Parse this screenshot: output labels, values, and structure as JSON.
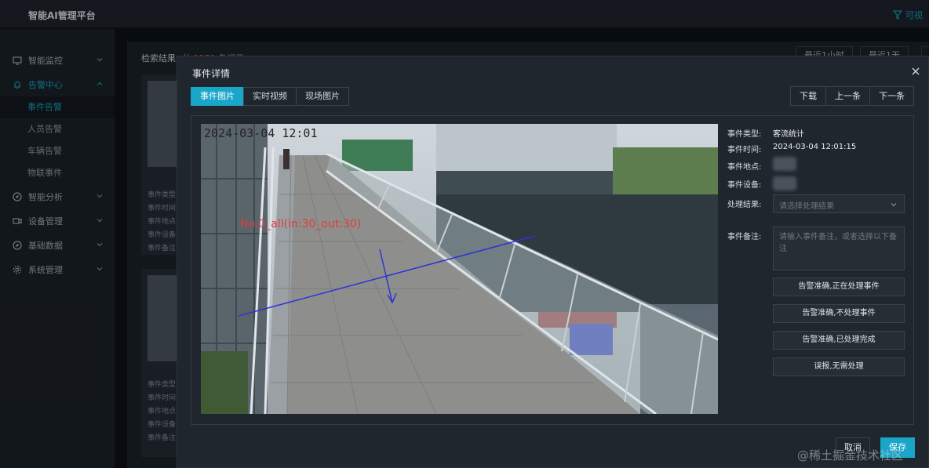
{
  "app": {
    "title": "智能AI管理平台",
    "top_right": "可视"
  },
  "sidebar": {
    "groups": [
      {
        "label": "智能监控",
        "icon": "monitor-icon"
      },
      {
        "label": "告警中心",
        "icon": "bell-icon"
      },
      {
        "label": "智能分析",
        "icon": "compass-icon"
      },
      {
        "label": "设备管理",
        "icon": "camera-icon"
      },
      {
        "label": "基础数据",
        "icon": "database-icon"
      },
      {
        "label": "系统管理",
        "icon": "gear-icon"
      }
    ],
    "alarm_items": [
      "事件告警",
      "人员告警",
      "车辆告警",
      "物联事件"
    ]
  },
  "results": {
    "label": "检索结果",
    "count_prefix": "共",
    "count": "1170",
    "count_suffix": "条记录",
    "ranges": [
      "最近1小时",
      "最近1天",
      "最"
    ]
  },
  "cards": {
    "lines": [
      "事件类型:",
      "事件时间:",
      "事件地点:",
      "事件设备:",
      "事件备注:"
    ]
  },
  "modal": {
    "title": "事件详情",
    "tabs": [
      "事件图片",
      "实时视频",
      "现场图片"
    ],
    "nav": [
      "下载",
      "上一条",
      "下一条"
    ],
    "photo": {
      "timestamp": "2024-03-04 12:01",
      "overlay_text": "No.0_all(in:30_out:30)"
    },
    "details": {
      "type_label": "事件类型:",
      "type_value": "客流统计",
      "time_label": "事件时间:",
      "time_value": "2024-03-04 12:01:15",
      "place_label": "事件地点:",
      "device_label": "事件设备:",
      "result_label": "处理结果:",
      "result_placeholder": "请选择处理结果",
      "note_label": "事件备注:",
      "note_placeholder": "请输入事件备注，或者选择以下备注"
    },
    "quick_notes": [
      "告警准确,正在处理事件",
      "告警准确,不处理事件",
      "告警准确,已处理完成",
      "误报,无需处理"
    ],
    "cancel": "取消",
    "save": "保存"
  },
  "watermark": "@稀土掘金技术社区",
  "colors": {
    "accent": "#1aa6c9",
    "count": "#e05454",
    "overlay_text": "#e23b3b",
    "counting_line": "#2d35d6"
  }
}
